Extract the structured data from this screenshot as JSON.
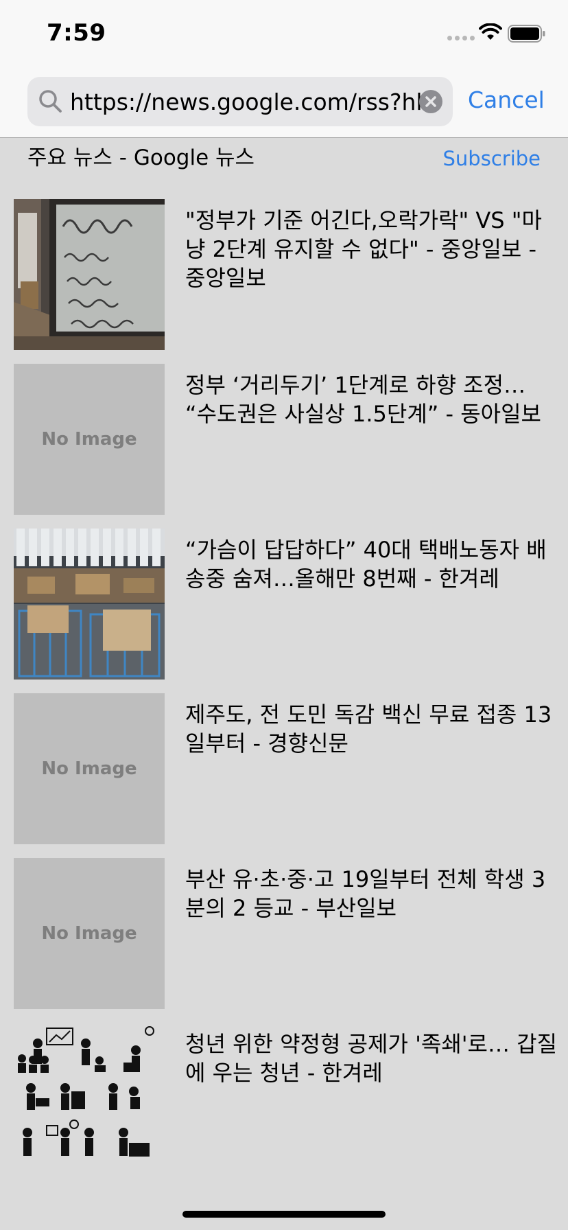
{
  "status_bar": {
    "time": "7:59"
  },
  "search": {
    "url_value": "https://news.google.com/rss?hl=",
    "cancel_label": "Cancel"
  },
  "feed": {
    "title": "주요 뉴스 - Google 뉴스",
    "subscribe_label": "Subscribe"
  },
  "placeholder_text": "No Image",
  "articles": [
    {
      "headline": "\"정부가 기준 어긴다,오락가락\" VS \"마냥 2단계 유지할 수 없다\" - 중앙일보 - 중앙일보",
      "has_image": true,
      "image": "cafe-window-sign-photo"
    },
    {
      "headline": "정부 ‘거리두기’ 1단계로 하향 조정… “수도권은 사실상 1.5단계” - 동아일보",
      "has_image": false
    },
    {
      "headline": "“가슴이 답답하다” 40대 택배노동자 배송중 숨져…올해만 8번째 - 한겨레",
      "has_image": true,
      "image": "parcel-warehouse-photo"
    },
    {
      "headline": "제주도, 전 도민 독감 백신 무료 접종 13일부터 - 경향신문",
      "has_image": false
    },
    {
      "headline": "부산 유·초·중·고 19일부터 전체 학생 3분의 2 등교 - 부산일보",
      "has_image": false
    },
    {
      "headline": "청년 위한 약정형 공제가 '족쇄'로… 갑질에 우는 청년 - 한겨레",
      "has_image": true,
      "image": "office-stress-pictograms"
    }
  ],
  "colors": {
    "accent": "#2f7fe6",
    "list_background": "#dbdbdb",
    "header_background": "#f8f8f8"
  }
}
